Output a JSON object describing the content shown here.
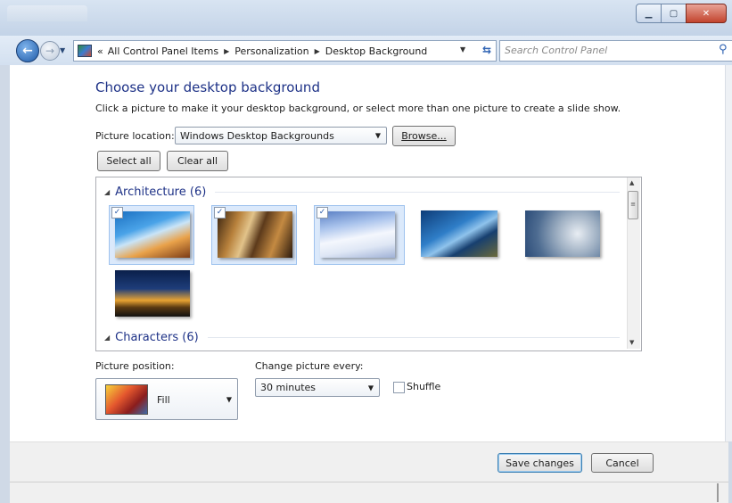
{
  "window": {
    "minimize_icon": "minimize-icon",
    "maximize_icon": "maximize-icon",
    "close_icon": "close-icon"
  },
  "nav": {
    "breadcrumb_prefix": "«",
    "breadcrumbs": [
      "All Control Panel Items",
      "Personalization",
      "Desktop Background"
    ],
    "search_placeholder": "Search Control Panel"
  },
  "page": {
    "title": "Choose your desktop background",
    "subtitle": "Click a picture to make it your desktop background, or select more than one picture to create a slide show.",
    "picture_location_label": "Picture location:",
    "picture_location_value": "Windows Desktop Backgrounds",
    "browse_label": "Browse...",
    "select_all_label": "Select all",
    "clear_all_label": "Clear all"
  },
  "gallery": {
    "groups": [
      {
        "name": "Architecture (6)",
        "images": [
          {
            "name": "tower-sky",
            "selected": true
          },
          {
            "name": "bronze-panels",
            "selected": true
          },
          {
            "name": "white-curved-building",
            "selected": true
          },
          {
            "name": "blue-glass-wall",
            "selected": false
          },
          {
            "name": "silver-disc-facade",
            "selected": false
          },
          {
            "name": "sunset-arch",
            "selected": false
          }
        ]
      },
      {
        "name": "Characters (6)",
        "images": []
      }
    ]
  },
  "options": {
    "picture_position_label": "Picture position:",
    "picture_position_value": "Fill",
    "change_every_label": "Change picture every:",
    "change_every_value": "30 minutes",
    "shuffle_label": "Shuffle",
    "shuffle_checked": false
  },
  "footer": {
    "save_label": "Save changes",
    "cancel_label": "Cancel"
  },
  "colors": {
    "title_blue": "#1e3287",
    "selection_bg": "#dbe9fb"
  }
}
